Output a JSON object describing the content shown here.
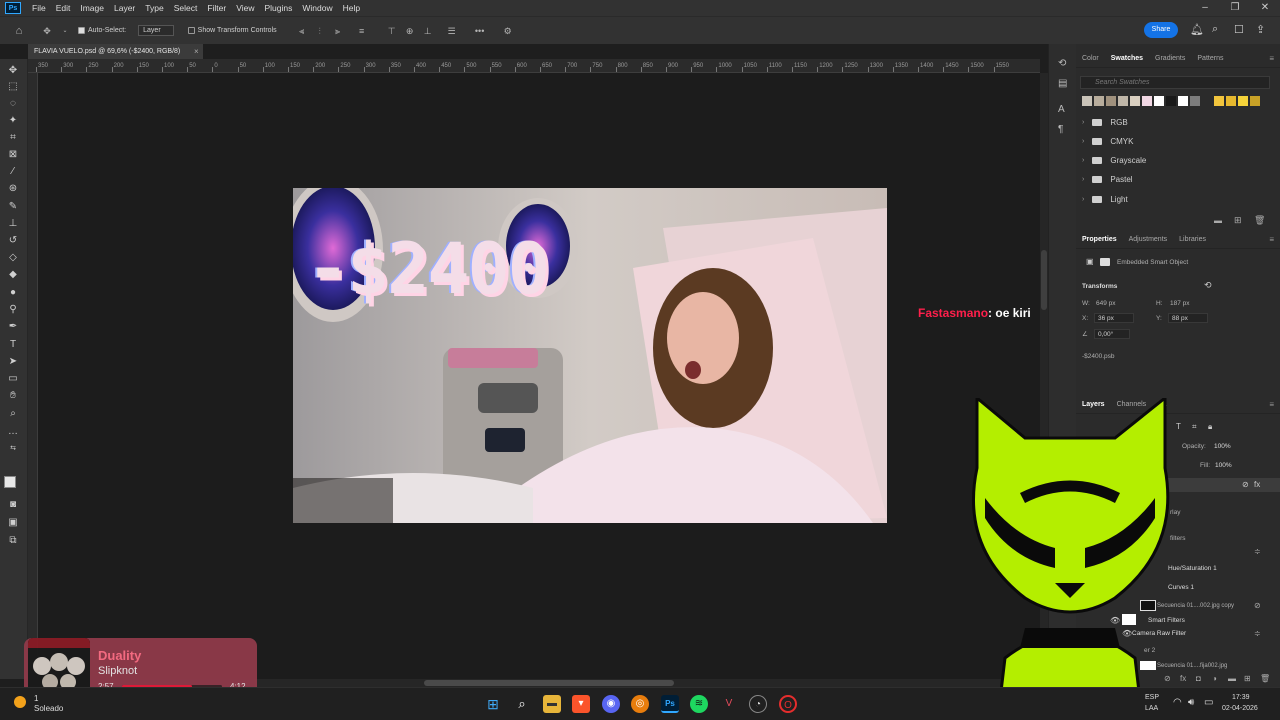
{
  "menubar": {
    "logo": "Ps",
    "items": [
      "File",
      "Edit",
      "Image",
      "Layer",
      "Type",
      "Select",
      "Filter",
      "View",
      "Plugins",
      "Window",
      "Help"
    ]
  },
  "options": {
    "auto_select_label": "Auto-Select:",
    "auto_select_target": "Layer",
    "transform_label": "Show Transform Controls",
    "share_label": "Share"
  },
  "document": {
    "tab_title": "FLAVIA VUELO.psd @ 69,6% (-$2400, RGB/8)",
    "overlay_text": "-$2400"
  },
  "ruler": {
    "ticks": [
      "350",
      "300",
      "250",
      "200",
      "150",
      "100",
      "50",
      "0",
      "50",
      "100",
      "150",
      "200",
      "250",
      "300",
      "350",
      "400",
      "450",
      "500",
      "550",
      "600",
      "650",
      "700",
      "750",
      "800",
      "850",
      "900",
      "950",
      "1000",
      "1050",
      "1100",
      "1150",
      "1200",
      "1250",
      "1300",
      "1350",
      "1400",
      "1450",
      "1500",
      "1550"
    ]
  },
  "swatches": {
    "tabs": [
      "Color",
      "Swatches",
      "Gradients",
      "Patterns"
    ],
    "active_tab": "Swatches",
    "search_placeholder": "Search Swatches",
    "colors": [
      "#c9c3b8",
      "#b8ad9c",
      "#a0917d",
      "#bfb6a8",
      "#d9cfc0",
      "#f2d8e4",
      "#ffffff",
      "#1a1a1a",
      "#ffffff",
      "#7d7d7d",
      "#f2c53d",
      "#e6b82e",
      "#f5d33a",
      "#c9a227"
    ],
    "groups": [
      "RGB",
      "CMYK",
      "Grayscale",
      "Pastel",
      "Light"
    ]
  },
  "properties": {
    "tabs": [
      "Properties",
      "Adjustments",
      "Libraries"
    ],
    "active_tab": "Properties",
    "object_type": "Embedded Smart Object",
    "section": "Transforms",
    "w_label": "W:",
    "w_value": "649 px",
    "h_label": "H:",
    "h_value": "187 px",
    "x_label": "X:",
    "x_value": "36 px",
    "y_label": "Y:",
    "y_value": "88 px",
    "angle_value": "0,00°",
    "file_name": "-$2400.psb"
  },
  "layers": {
    "tabs": [
      "Layers",
      "Channels",
      "Pa"
    ],
    "active_tab": "Layers",
    "opacity_label": "Opacity:",
    "opacity_value": "100%",
    "fill_label": "Fill:",
    "fill_value": "100%",
    "items": [
      "rlay",
      "filters",
      "Hue/Saturation 1",
      "Curves 1",
      "Secuencia 01....002.jpg copy",
      "Smart Filters",
      "Camera Raw Filter",
      "er 2",
      "Secuencia 01....fija002.jpg"
    ]
  },
  "chat": {
    "user": "Fastasmano",
    "separator": ":",
    "message": "oe kiri"
  },
  "now_playing": {
    "title": "Duality",
    "artist": "Slipknot",
    "current": "2:57",
    "duration": "4:12",
    "progress_fraction": 0.7
  },
  "taskbar": {
    "weather_temp": "1",
    "weather_text": "Soleado",
    "lang1": "ESP",
    "lang2": "LAA",
    "time": "17:39",
    "date": "02-04-2026"
  },
  "colors": {
    "accent": "#1473e6",
    "chat_user": "#ff1f4b",
    "mascot": "#b4ee00",
    "player_bg": "#8f3a4a",
    "player_title": "#ff6f86"
  }
}
